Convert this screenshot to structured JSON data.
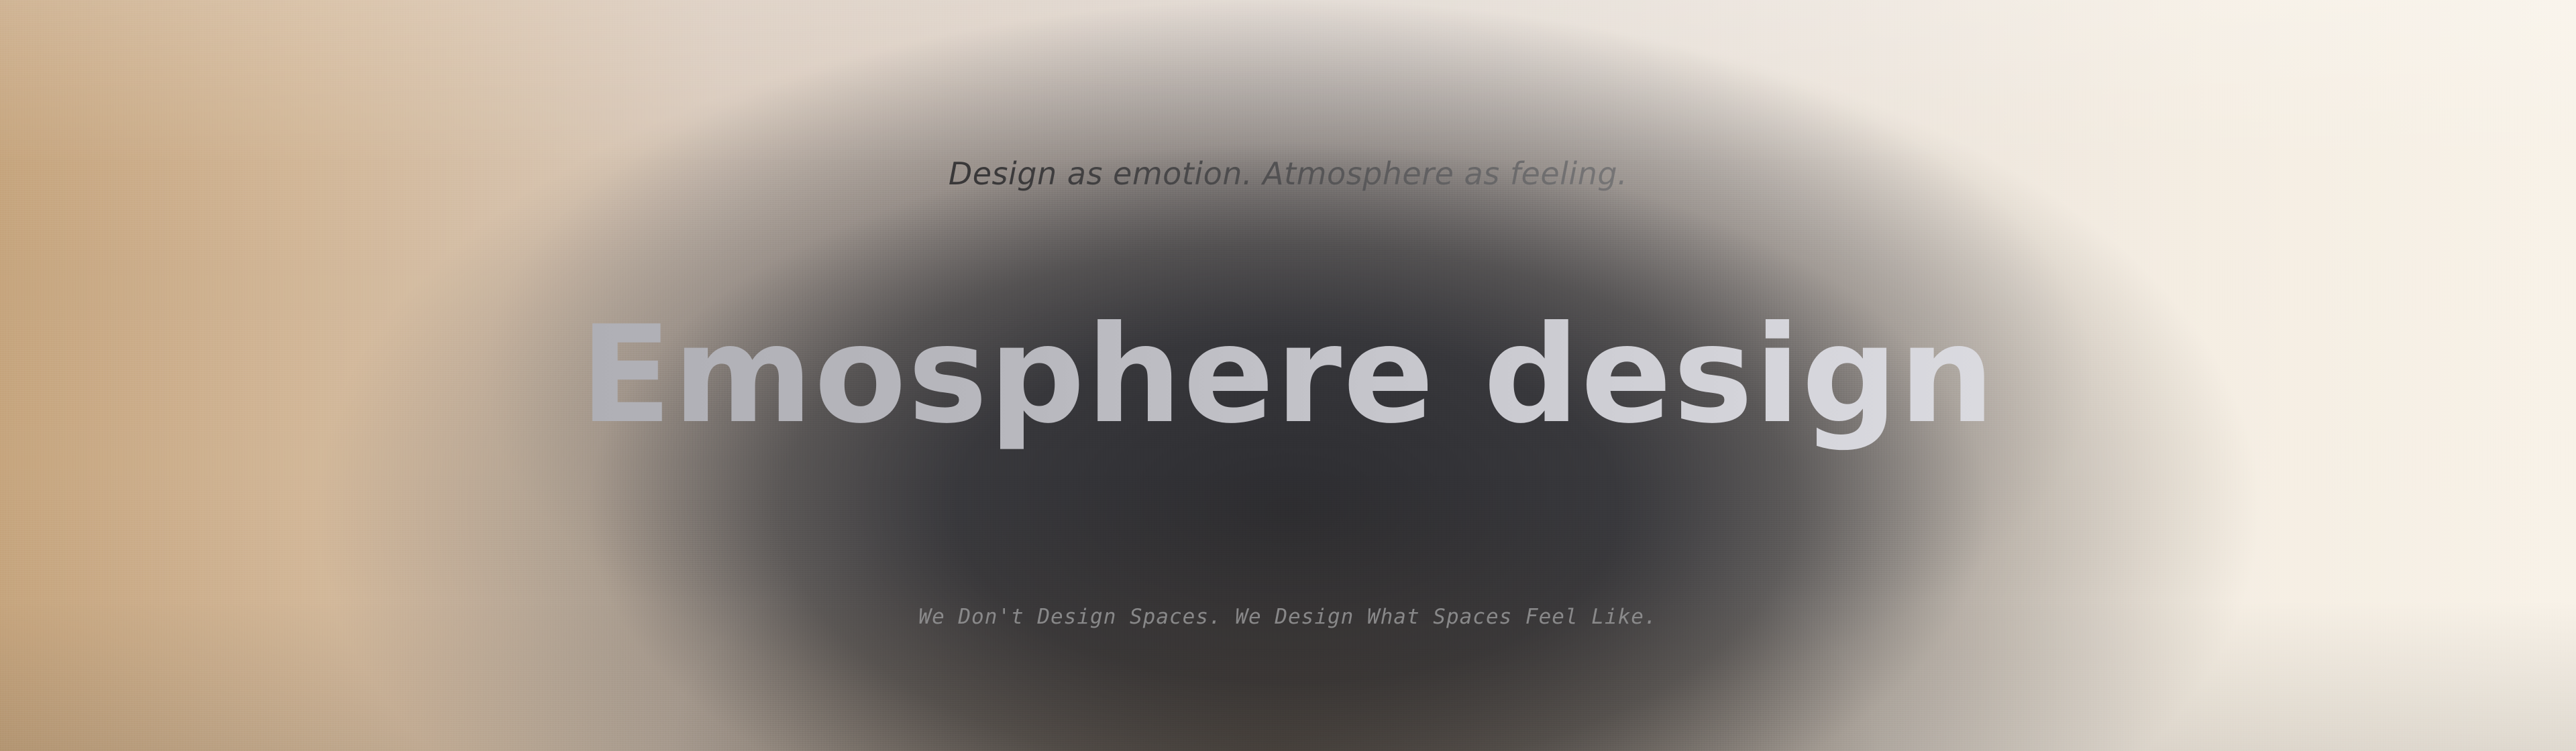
{
  "hero": {
    "tagline": "Design as emotion. Atmosphere as feeling.",
    "title": "Emosphere design",
    "subline": "We Don't Design Spaces. We Design What Spaces Feel Like."
  },
  "colors": {
    "background_left": "#c6a57e",
    "background_right": "#f8f2e8",
    "center_glow": "#2c2c30",
    "title_gradient_start": "#a3a3a9",
    "title_gradient_end": "#e6e6ea"
  }
}
